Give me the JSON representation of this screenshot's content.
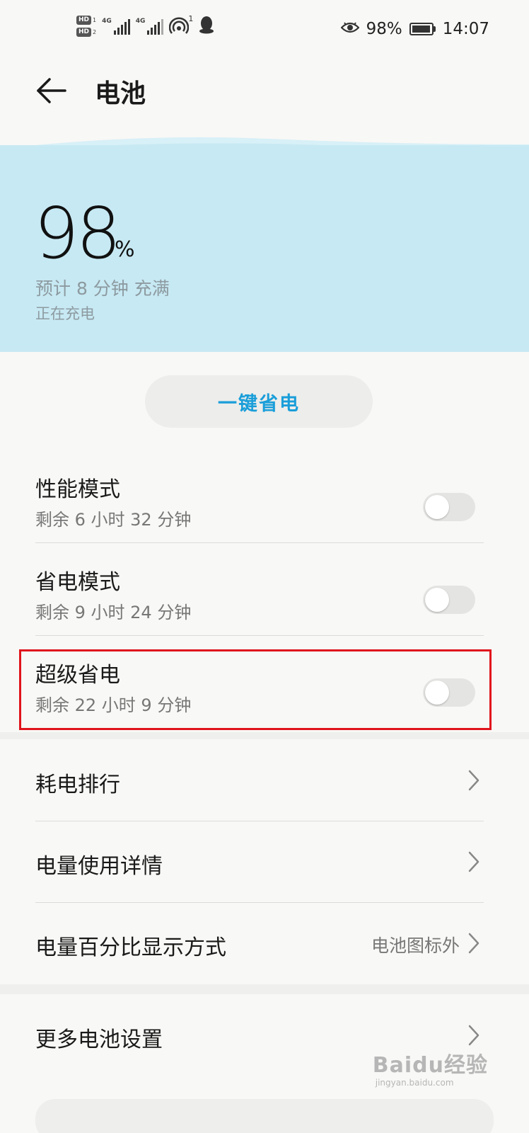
{
  "status_bar": {
    "sim1_label": "HD",
    "sim1_index": "1",
    "sim2_label": "HD",
    "sim2_index": "2",
    "net1": "4G",
    "net2": "4G",
    "hotspot_count": "1",
    "battery_percent": "98%",
    "time": "14:07"
  },
  "header": {
    "title": "电池"
  },
  "battery": {
    "level": "98",
    "unit": "%",
    "eta": "预计 8 分钟 充满",
    "status": "正在充电"
  },
  "save_button": {
    "label": "一键省电"
  },
  "modes": [
    {
      "title": "性能模式",
      "remaining": "剩余 6 小时 32 分钟",
      "enabled": false
    },
    {
      "title": "省电模式",
      "remaining": "剩余 9 小时 24 分钟",
      "enabled": false
    },
    {
      "title": "超级省电",
      "remaining": "剩余 22 小时 9 分钟",
      "enabled": false
    }
  ],
  "nav": [
    {
      "label": "耗电排行"
    },
    {
      "label": "电量使用详情"
    },
    {
      "label": "电量百分比显示方式",
      "value": "电池图标外"
    },
    {
      "label": "更多电池设置"
    }
  ],
  "watermark": {
    "brand": "Baidu经验",
    "url": "jingyan.baidu.com"
  },
  "colors": {
    "accent": "#1a9ed9",
    "hero_bg": "#c7e9f3",
    "highlight": "#e0141c"
  }
}
